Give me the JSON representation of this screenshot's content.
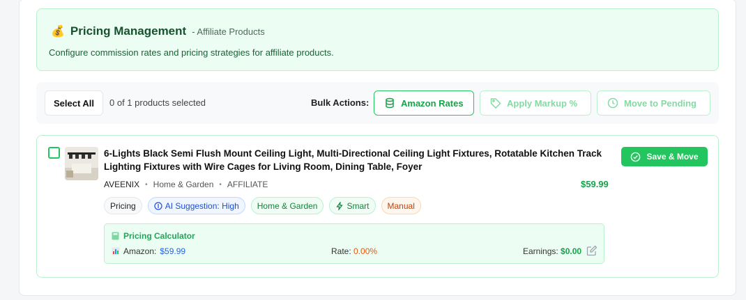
{
  "header": {
    "icon": "money-bag-icon",
    "title": "Pricing Management",
    "subtitle": "- Affiliate Products",
    "description": "Configure commission rates and pricing strategies for affiliate products."
  },
  "bulk": {
    "select_all": "Select All",
    "selected_text": "0 of 1 products selected",
    "label": "Bulk Actions:",
    "amazon_rates": "Amazon Rates",
    "apply_markup": "Apply Markup %",
    "move_to_pending": "Move to Pending"
  },
  "product": {
    "title": "6-Lights Black Semi Flush Mount Ceiling Light, Multi-Directional Ceiling Light Fixtures, Rotatable Kitchen Track Lighting Fixtures with Wire Cages for Living Room, Dining Table, Foyer",
    "brand": "AVEENIX",
    "category": "Home & Garden",
    "type": "AFFILIATE",
    "price": "$59.99",
    "save_button": "Save & Move",
    "checked": false,
    "tags": {
      "pricing": "Pricing",
      "ai": "AI Suggestion: High",
      "category": "Home & Garden",
      "smart": "Smart",
      "manual": "Manual"
    },
    "calculator": {
      "title": "Pricing Calculator",
      "amazon_label": "Amazon:",
      "amazon_value": "$59.99",
      "rate_label": "Rate:",
      "rate_value": "0.00%",
      "earnings_label": "Earnings:",
      "earnings_value": "$0.00"
    }
  },
  "colors": {
    "accent_green": "#22c55e",
    "header_bg": "#ecfdf3",
    "rate_orange": "#ea580c",
    "amazon_blue": "#2563eb"
  }
}
